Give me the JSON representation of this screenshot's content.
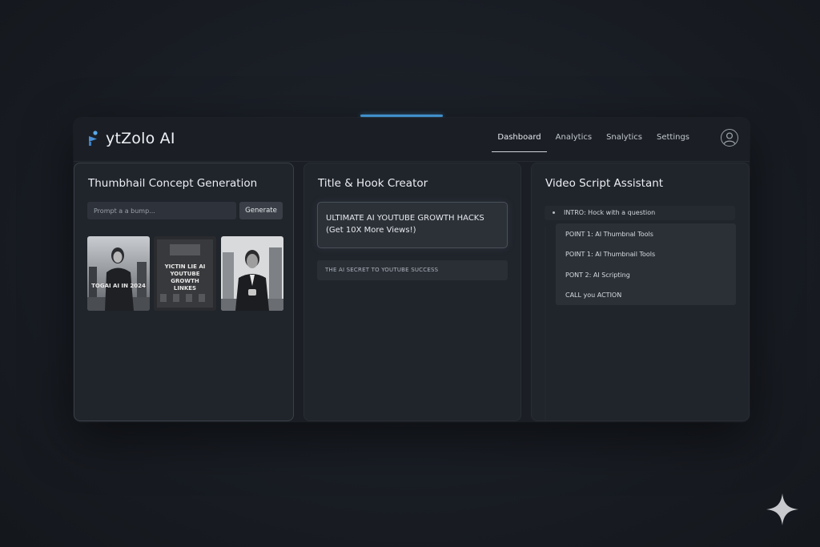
{
  "app": {
    "title": "ytZolo AI"
  },
  "nav": {
    "items": [
      {
        "label": "Dashboard",
        "active": true
      },
      {
        "label": "Analytics",
        "active": false
      },
      {
        "label": "Snalytics",
        "active": false
      },
      {
        "label": "Settings",
        "active": false
      }
    ]
  },
  "thumbnail_panel": {
    "title": "Thumbhail Concept Generation",
    "prompt_placeholder": "Prompt a a bump...",
    "generate_label": "Generate",
    "thumbnails": [
      {
        "text": "TOGAI AI IN 2024"
      },
      {
        "text": "YICTIN LIE AI YOUTUBE GROWTH LINKES"
      },
      {
        "text": ""
      }
    ]
  },
  "hook_panel": {
    "title": "Title & Hook Creator",
    "primary_line1": "ULTIMATE AI YOUTUBE GROWTH HACKS",
    "primary_line2": "(Get 10X More Views!)",
    "secondary": "THE AI SECRET TO YOUTUBE SUCCESS"
  },
  "script_panel": {
    "title": "Video Script Assistant",
    "intro": "INTRO: Hock with a question",
    "items": [
      "POINT 1: AI Thumbnal Tools",
      "POINT 1: AI Thumbnail Tools",
      "PONT 2: AI Scripting",
      "CALL you ACTION"
    ]
  },
  "colors": {
    "accent": "#4aa3e6",
    "background": "#191d24",
    "panel": "#20242b"
  }
}
